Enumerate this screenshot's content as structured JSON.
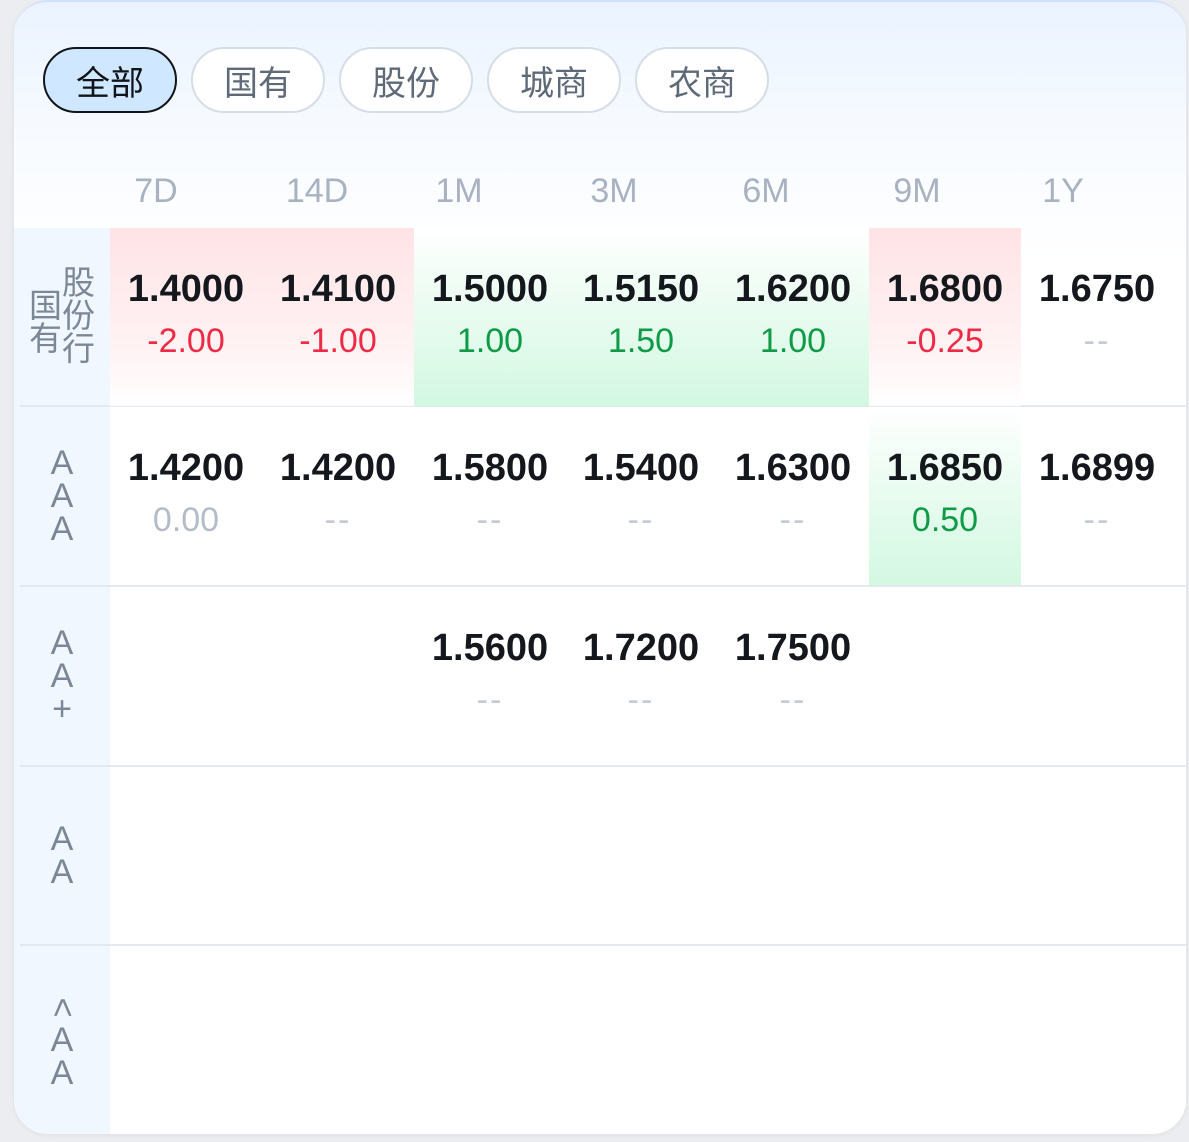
{
  "filters": [
    {
      "label": "全部",
      "active": true
    },
    {
      "label": "国有",
      "active": false
    },
    {
      "label": "股份",
      "active": false
    },
    {
      "label": "城商",
      "active": false
    },
    {
      "label": "农商",
      "active": false
    }
  ],
  "columns": [
    "7D",
    "14D",
    "1M",
    "3M",
    "6M",
    "9M",
    "1Y"
  ],
  "rows": [
    {
      "label": "国有股份行",
      "label_left": [
        "国",
        "有"
      ],
      "label_right": [
        "股",
        "份",
        "行"
      ],
      "cells": [
        {
          "value": "1.4000",
          "change": "-2.00",
          "trend": "down"
        },
        {
          "value": "1.4100",
          "change": "-1.00",
          "trend": "down"
        },
        {
          "value": "1.5000",
          "change": "1.00",
          "trend": "up"
        },
        {
          "value": "1.5150",
          "change": "1.50",
          "trend": "up"
        },
        {
          "value": "1.6200",
          "change": "1.00",
          "trend": "up"
        },
        {
          "value": "1.6800",
          "change": "-0.25",
          "trend": "down"
        },
        {
          "value": "1.6750",
          "change": "--",
          "trend": "none"
        }
      ]
    },
    {
      "label": "AAA",
      "label_chars": [
        "A",
        "A",
        "A"
      ],
      "cells": [
        {
          "value": "1.4200",
          "change": "0.00",
          "trend": "zero"
        },
        {
          "value": "1.4200",
          "change": "--",
          "trend": "none"
        },
        {
          "value": "1.5800",
          "change": "--",
          "trend": "none"
        },
        {
          "value": "1.5400",
          "change": "--",
          "trend": "none"
        },
        {
          "value": "1.6300",
          "change": "--",
          "trend": "none"
        },
        {
          "value": "1.6850",
          "change": "0.50",
          "trend": "up"
        },
        {
          "value": "1.6899",
          "change": "--",
          "trend": "none"
        }
      ]
    },
    {
      "label": "AA+",
      "label_chars": [
        "A",
        "A",
        "+"
      ],
      "cells": [
        {
          "value": "",
          "change": "",
          "trend": "empty"
        },
        {
          "value": "",
          "change": "",
          "trend": "empty"
        },
        {
          "value": "1.5600",
          "change": "--",
          "trend": "none"
        },
        {
          "value": "1.7200",
          "change": "--",
          "trend": "none"
        },
        {
          "value": "1.7500",
          "change": "--",
          "trend": "none"
        },
        {
          "value": "",
          "change": "",
          "trend": "empty"
        },
        {
          "value": "",
          "change": "",
          "trend": "empty"
        }
      ]
    },
    {
      "label": "AA",
      "label_chars": [
        "A",
        "A"
      ],
      "cells": []
    },
    {
      "label": "<AA",
      "label_chars": [
        "<",
        "A",
        "A"
      ],
      "cells": []
    }
  ],
  "colors": {
    "down": "#ee2b46",
    "up": "#0f9a48",
    "muted": "#b4bcc8",
    "active_tab_bg": "#cfe7ff"
  }
}
